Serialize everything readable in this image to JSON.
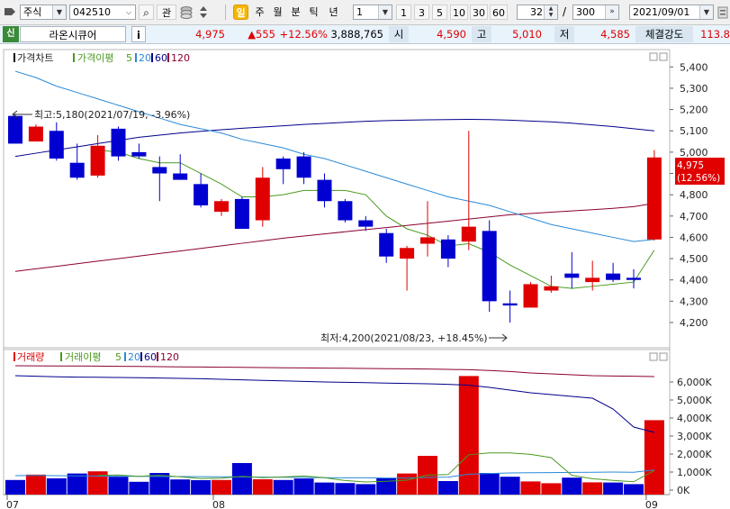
{
  "toolbar": {
    "market": "주식",
    "code": "042510",
    "btn_search": "⌕",
    "btn_watch": "관",
    "period_active": "일",
    "periods": [
      "주",
      "월",
      "분",
      "틱",
      "년"
    ],
    "interval_select": "1",
    "interval_buttons": [
      "1",
      "3",
      "5",
      "10",
      "30",
      "60"
    ],
    "count_value": "32",
    "count_sep": "/",
    "count_total": "300",
    "date": "2021/09/01"
  },
  "info": {
    "badge": "신",
    "name": "라온시큐어",
    "info_btn": "i",
    "price": "4,975",
    "change": "▲555",
    "change_pct": "+12.56%",
    "volume": "3,888,765",
    "open_label": "시",
    "open": "4,590",
    "high_label": "고",
    "high": "5,010",
    "low_label": "저",
    "low": "4,585",
    "strength_label": "체결강도",
    "strength": "113.8"
  },
  "price_pane": {
    "legend": {
      "title": "가격차트",
      "ma_label": "가격이평",
      "ma5": "5",
      "ma20": "20",
      "ma60": "60",
      "ma120": "120"
    },
    "y_ticks": [
      "5,400",
      "5,300",
      "5,200",
      "5,100",
      "5,000",
      "4,900",
      "4,800",
      "4,700",
      "4,600",
      "4,500",
      "4,400",
      "4,300",
      "4,200"
    ],
    "last_price_tag": "4,975",
    "last_pct_tag": "(12.56%)",
    "max_annotation": "최고:5,180(2021/07/19, -3.96%)",
    "min_annotation": "최저:4,200(2021/08/23, +18.45%)"
  },
  "volume_pane": {
    "legend": {
      "title": "거래량",
      "ma_label": "거래이평",
      "ma5": "5",
      "ma20": "20",
      "ma60": "60",
      "ma120": "120"
    },
    "y_ticks": [
      "6,000K",
      "5,000K",
      "4,000K",
      "3,000K",
      "2,000K",
      "1,000K",
      "0K"
    ]
  },
  "x_labels": [
    "07",
    "08",
    "09"
  ],
  "colors": {
    "up": "#e00000",
    "down": "#0000d0",
    "ma5": "#4a9a20",
    "ma20": "#2a8ad8",
    "ma60": "#00008b",
    "ma120": "#8b0030"
  },
  "chart_data": {
    "type": "candlestick",
    "candles": [
      {
        "o": 5170,
        "h": 5180,
        "l": 5040,
        "c": 5040
      },
      {
        "o": 5050,
        "h": 5130,
        "l": 5050,
        "c": 5120
      },
      {
        "o": 5100,
        "h": 5140,
        "l": 4960,
        "c": 4970
      },
      {
        "o": 4950,
        "h": 5040,
        "l": 4870,
        "c": 4880
      },
      {
        "o": 4890,
        "h": 5080,
        "l": 4880,
        "c": 5030
      },
      {
        "o": 5110,
        "h": 5120,
        "l": 4960,
        "c": 4980
      },
      {
        "o": 5000,
        "h": 5040,
        "l": 4970,
        "c": 4980
      },
      {
        "o": 4930,
        "h": 4980,
        "l": 4770,
        "c": 4900
      },
      {
        "o": 4900,
        "h": 4990,
        "l": 4870,
        "c": 4870
      },
      {
        "o": 4850,
        "h": 4900,
        "l": 4740,
        "c": 4750
      },
      {
        "o": 4720,
        "h": 4780,
        "l": 4700,
        "c": 4770
      },
      {
        "o": 4780,
        "h": 4790,
        "l": 4640,
        "c": 4640
      },
      {
        "o": 4680,
        "h": 4930,
        "l": 4650,
        "c": 4880
      },
      {
        "o": 4970,
        "h": 4980,
        "l": 4850,
        "c": 4920
      },
      {
        "o": 4980,
        "h": 5000,
        "l": 4850,
        "c": 4880
      },
      {
        "o": 4870,
        "h": 4900,
        "l": 4740,
        "c": 4770
      },
      {
        "o": 4770,
        "h": 4780,
        "l": 4670,
        "c": 4680
      },
      {
        "o": 4680,
        "h": 4700,
        "l": 4630,
        "c": 4650
      },
      {
        "o": 4620,
        "h": 4640,
        "l": 4480,
        "c": 4510
      },
      {
        "o": 4500,
        "h": 4560,
        "l": 4350,
        "c": 4550
      },
      {
        "o": 4570,
        "h": 4770,
        "l": 4510,
        "c": 4600
      },
      {
        "o": 4590,
        "h": 4610,
        "l": 4460,
        "c": 4500
      },
      {
        "o": 4580,
        "h": 5100,
        "l": 4540,
        "c": 4650
      },
      {
        "o": 4630,
        "h": 4680,
        "l": 4250,
        "c": 4300
      },
      {
        "o": 4290,
        "h": 4350,
        "l": 4200,
        "c": 4280
      },
      {
        "o": 4270,
        "h": 4390,
        "l": 4270,
        "c": 4380
      },
      {
        "o": 4350,
        "h": 4420,
        "l": 4340,
        "c": 4370
      },
      {
        "o": 4430,
        "h": 4530,
        "l": 4360,
        "c": 4410
      },
      {
        "o": 4390,
        "h": 4490,
        "l": 4350,
        "c": 4410
      },
      {
        "o": 4430,
        "h": 4480,
        "l": 4390,
        "c": 4400
      },
      {
        "o": 4410,
        "h": 4450,
        "l": 4360,
        "c": 4400
      },
      {
        "o": 4590,
        "h": 5010,
        "l": 4585,
        "c": 4975
      }
    ],
    "volume_k": [
      560,
      860,
      650,
      920,
      1040,
      740,
      460,
      950,
      590,
      550,
      560,
      1500,
      600,
      560,
      640,
      420,
      390,
      330,
      650,
      920,
      1900,
      500,
      6330,
      950,
      740,
      480,
      380,
      690,
      430,
      420,
      330,
      3880
    ],
    "ma5": [
      null,
      null,
      null,
      null,
      5010,
      5000,
      4970,
      4950,
      4950,
      4900,
      4850,
      4790,
      4790,
      4800,
      4820,
      4820,
      4820,
      4800,
      4700,
      4640,
      4610,
      4560,
      4570,
      4530,
      4470,
      4420,
      4370,
      4360,
      4370,
      4380,
      4390,
      4540
    ],
    "ma20": [
      5380,
      5350,
      5310,
      5280,
      5250,
      5220,
      5190,
      5160,
      5130,
      5110,
      5090,
      5060,
      5040,
      5020,
      4990,
      4970,
      4940,
      4910,
      4880,
      4850,
      4820,
      4790,
      4770,
      4750,
      4720,
      4690,
      4660,
      4640,
      4620,
      4600,
      4580,
      4590
    ],
    "ma60": [
      4980,
      4995,
      5010,
      5025,
      5040,
      5055,
      5070,
      5080,
      5090,
      5098,
      5105,
      5112,
      5118,
      5124,
      5130,
      5135,
      5140,
      5145,
      5148,
      5150,
      5152,
      5153,
      5154,
      5153,
      5150,
      5146,
      5142,
      5136,
      5128,
      5120,
      5110,
      5100
    ],
    "ma120": [
      4440,
      4452,
      4464,
      4476,
      4488,
      4500,
      4512,
      4524,
      4536,
      4548,
      4560,
      4572,
      4584,
      4596,
      4606,
      4616,
      4626,
      4636,
      4646,
      4656,
      4666,
      4676,
      4686,
      4696,
      4706,
      4712,
      4718,
      4724,
      4730,
      4736,
      4744,
      4760
    ],
    "vma5": [
      null,
      null,
      null,
      null,
      810,
      840,
      760,
      820,
      740,
      640,
      660,
      760,
      690,
      730,
      780,
      690,
      530,
      450,
      490,
      550,
      830,
      860,
      1960,
      2060,
      2060,
      1980,
      1800,
      820,
      630,
      540,
      460,
      1090
    ],
    "vma20": [
      800,
      810,
      800,
      790,
      780,
      770,
      760,
      755,
      750,
      745,
      740,
      730,
      720,
      710,
      700,
      690,
      680,
      680,
      670,
      670,
      700,
      720,
      880,
      920,
      950,
      960,
      970,
      980,
      990,
      1000,
      990,
      1120
    ],
    "vma60": [
      6350,
      6320,
      6290,
      6270,
      6260,
      6250,
      6240,
      6220,
      6200,
      6180,
      6150,
      6120,
      6090,
      6060,
      6030,
      6000,
      5980,
      5960,
      5940,
      5920,
      5900,
      5870,
      5820,
      5700,
      5550,
      5400,
      5300,
      5200,
      5100,
      4500,
      3500,
      3200
    ],
    "vma120": [
      6900,
      6895,
      6890,
      6885,
      6880,
      6870,
      6860,
      6850,
      6840,
      6830,
      6820,
      6810,
      6800,
      6790,
      6780,
      6770,
      6760,
      6750,
      6740,
      6730,
      6720,
      6700,
      6680,
      6640,
      6580,
      6500,
      6450,
      6400,
      6350,
      6330,
      6320,
      6300
    ],
    "price_ylim": [
      4150,
      5450
    ],
    "volume_ylim": [
      0,
      6800
    ],
    "x_label_index": {
      "07": 0,
      "08": 10,
      "09": 31
    }
  }
}
